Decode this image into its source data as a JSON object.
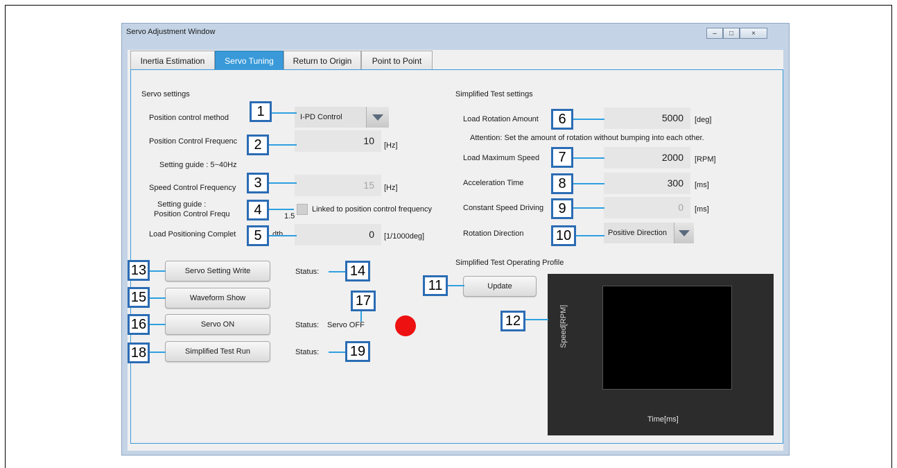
{
  "window": {
    "title": "Servo Adjustment Window",
    "controls": [
      "minimize-icon",
      "maximize-icon",
      "close-icon"
    ]
  },
  "tabs": [
    {
      "label": "Inertia Estimation",
      "active": false
    },
    {
      "label": "Servo Tuning",
      "active": true
    },
    {
      "label": "Return to Origin",
      "active": false
    },
    {
      "label": "Point to Point",
      "active": false
    }
  ],
  "servo_settings": {
    "heading": "Servo settings",
    "position_control_method_label": "Position control method",
    "position_control_method_value": "I-PD Control",
    "position_control_frequency_label": "Position Control Frequenc",
    "position_control_frequency_value": "10",
    "position_control_frequency_unit": "[Hz]",
    "position_guide": "Setting guide : 5~40Hz",
    "speed_control_frequency_label": "Speed Control Frequency",
    "speed_control_frequency_value": "15",
    "speed_control_frequency_unit": "[Hz]",
    "speed_guide_line1": "Setting guide :",
    "speed_guide_line2": "Position Control Frequ",
    "speed_guide_multiplier": "1.5",
    "linked_checkbox_label": "Linked to position control frequency",
    "load_positioning_label": "Load Positioning Complet",
    "load_positioning_label_tail": "dth",
    "load_positioning_value": "0",
    "load_positioning_unit": "[1/1000deg]"
  },
  "test_settings": {
    "heading": "Simplified Test settings",
    "load_rotation_label": "Load Rotation Amount",
    "load_rotation_value": "5000",
    "load_rotation_unit": "[deg]",
    "attention": "Attention: Set the amount of rotation without bumping into each other.",
    "max_speed_label": "Load Maximum Speed",
    "max_speed_value": "2000",
    "max_speed_unit": "[RPM]",
    "accel_label": "Acceleration Time",
    "accel_value": "300",
    "accel_unit": "[ms]",
    "constant_label": "Constant Speed Driving",
    "constant_value": "0",
    "constant_unit": "[ms]",
    "rotation_label": "Rotation Direction",
    "rotation_value": "Positive Direction"
  },
  "actions": {
    "write_button": "Servo Setting Write",
    "waveform_button": "Waveform Show",
    "servo_on_button": "Servo ON",
    "test_run_button": "Simplified Test Run",
    "status_label": "Status:",
    "servo_status_value": "Servo OFF",
    "servo_led_color": "#ee1111"
  },
  "profile": {
    "heading": "Simplified Test Operating Profile",
    "update_button": "Update",
    "ylabel": "Speed[RPM]",
    "xlabel": "Time[ms]"
  },
  "callouts": [
    "1",
    "2",
    "3",
    "4",
    "5",
    "6",
    "7",
    "8",
    "9",
    "10",
    "11",
    "12",
    "13",
    "14",
    "15",
    "16",
    "17",
    "18",
    "19"
  ],
  "colors": {
    "active_tab": "#3a9ad9",
    "callout_border": "#2b6cb4",
    "callout_line": "#2ea0e0",
    "plot_bg": "#2c2c2c"
  }
}
